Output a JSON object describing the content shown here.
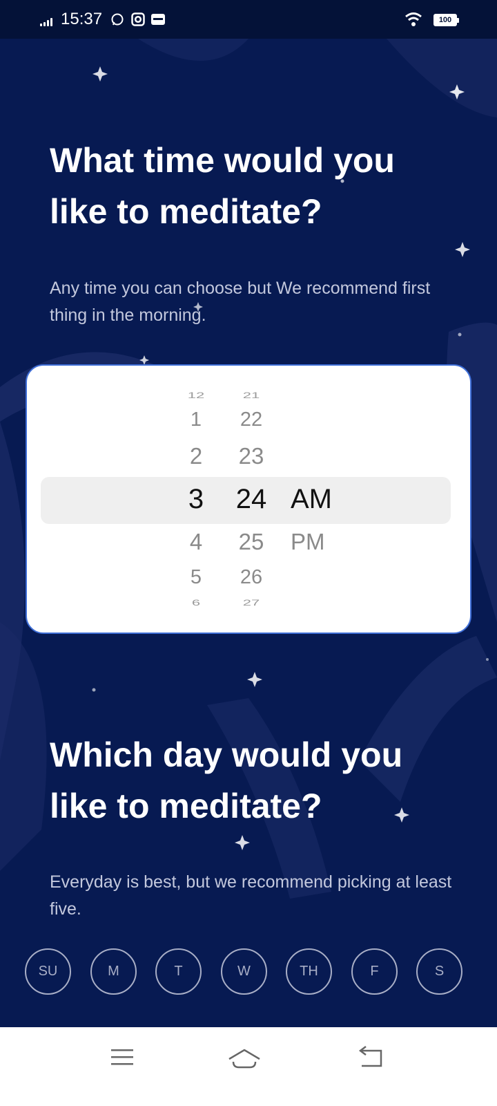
{
  "status_bar": {
    "time": "15:37",
    "battery": "100",
    "icons": [
      "signal-icon",
      "whatsapp-icon",
      "instagram-icon",
      "paytm-icon",
      "wifi-icon",
      "battery-icon"
    ]
  },
  "time_section": {
    "title": "What time would you like to meditate?",
    "subtitle": "Any time you can choose but We recommend first thing in the morning."
  },
  "time_picker": {
    "hours": [
      "12",
      "1",
      "2",
      "3",
      "4",
      "5",
      "6"
    ],
    "minutes": [
      "21",
      "22",
      "23",
      "24",
      "25",
      "26",
      "27"
    ],
    "periods": [
      "AM",
      "PM"
    ],
    "selected_hour": "3",
    "selected_minute": "24",
    "selected_period": "AM"
  },
  "day_section": {
    "title": "Which day would you like to meditate?",
    "subtitle": "Everyday is best, but we recommend picking at least five.",
    "days": [
      "SU",
      "M",
      "T",
      "W",
      "TH",
      "F",
      "S"
    ]
  },
  "colors": {
    "background": "#071a52",
    "card": "#ffffff",
    "card_border": "#3f6fd8",
    "chip_border": "#a8aec6"
  }
}
